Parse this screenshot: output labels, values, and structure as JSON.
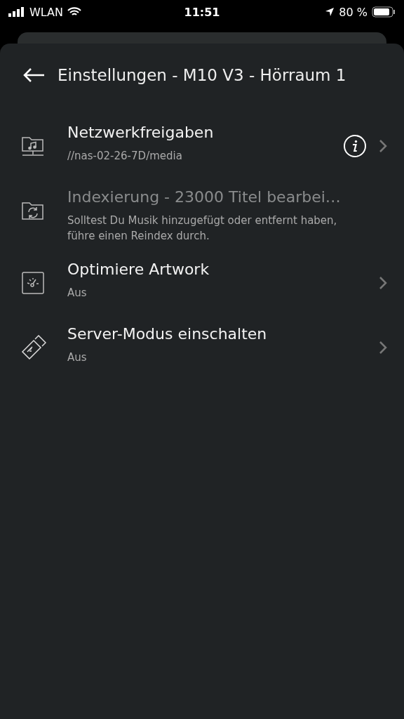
{
  "status_bar": {
    "carrier": "WLAN",
    "time": "11:51",
    "battery": "80 %"
  },
  "header": {
    "title": "Einstellungen - M10 V3 - Hörraum 1"
  },
  "items": [
    {
      "kind": "share",
      "title": "Netzwerkfreigaben",
      "subtitle": "//nas-02-26-7D/media",
      "disabled": false,
      "info": true
    },
    {
      "kind": "reindex",
      "title": "Indexierung - 23000 Titel bearbei…",
      "subtitle": "Solltest Du Musik hinzugefügt oder entfernt haben, führe einen Reindex durch.",
      "disabled": true,
      "info": false
    },
    {
      "kind": "gauge",
      "title": "Optimiere Artwork",
      "subtitle": "Aus",
      "disabled": false,
      "info": false
    },
    {
      "kind": "usb",
      "title": "Server-Modus einschalten",
      "subtitle": "Aus",
      "disabled": false,
      "info": false
    }
  ]
}
